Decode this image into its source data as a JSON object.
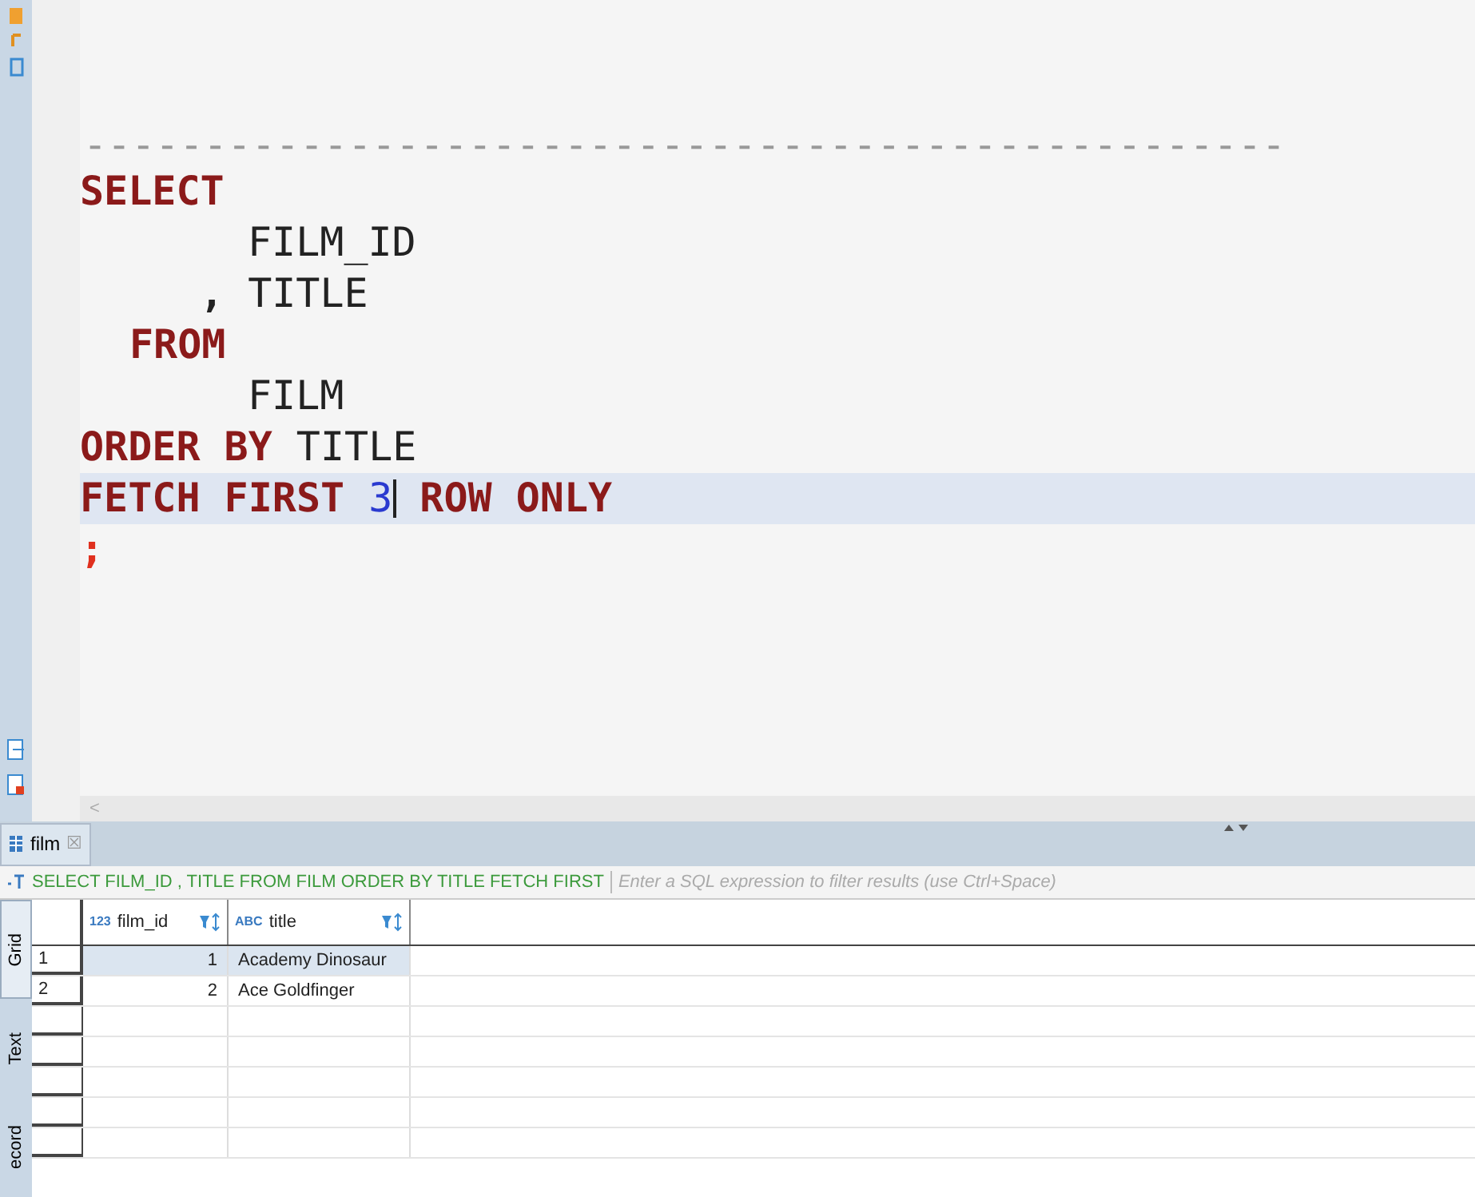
{
  "editor": {
    "comment": "--------------------------------------------------",
    "lines": [
      {
        "kind": "clause",
        "current": false,
        "tokens": [
          {
            "kind": "keyword",
            "text": "SELECT"
          }
        ]
      },
      {
        "kind": "item",
        "current": false,
        "tokens": [
          {
            "kind": "ident",
            "text": "FILM_ID"
          }
        ]
      },
      {
        "kind": "comma_item",
        "current": false,
        "tokens": [
          {
            "kind": "punct",
            "text": ","
          },
          {
            "kind": "ident",
            "text": "TITLE"
          }
        ]
      },
      {
        "kind": "sub_clause",
        "current": false,
        "tokens": [
          {
            "kind": "keyword",
            "text": "FROM"
          }
        ]
      },
      {
        "kind": "item",
        "current": false,
        "tokens": [
          {
            "kind": "ident",
            "text": "FILM"
          }
        ]
      },
      {
        "kind": "clause",
        "current": false,
        "tokens": [
          {
            "kind": "keyword",
            "text": "ORDER BY"
          },
          {
            "kind": "ident",
            "text": "TITLE"
          }
        ]
      },
      {
        "kind": "clause",
        "current": true,
        "tokens": [
          {
            "kind": "keyword",
            "text": "FETCH FIRST"
          },
          {
            "kind": "number",
            "text": "3",
            "cursor": true
          },
          {
            "kind": "keyword",
            "text": "ROW ONLY"
          }
        ]
      },
      {
        "kind": "clause",
        "current": false,
        "tokens": [
          {
            "kind": "terminator",
            "text": ";"
          }
        ]
      }
    ],
    "scroll_left": "<"
  },
  "results": {
    "tab": {
      "label": "film",
      "close": "☒"
    },
    "query": "SELECT FILM_ID , TITLE FROM FILM ORDER BY TITLE FETCH FIRST",
    "filter": {
      "placeholder": "Enter a SQL expression to filter results (use Ctrl+Space)"
    },
    "side_tabs": [
      {
        "label": "Grid",
        "selected": true
      },
      {
        "label": "Text",
        "selected": false
      },
      {
        "label": "ecord",
        "selected": false
      }
    ],
    "columns": [
      {
        "type": "123",
        "name": "film_id",
        "kind": "numeric"
      },
      {
        "type": "ABC",
        "name": "title",
        "kind": "text"
      }
    ],
    "rows": [
      {
        "number": "1",
        "selected": true,
        "cells": [
          "1",
          "Academy Dinosaur"
        ]
      },
      {
        "number": "2",
        "selected": false,
        "cells": [
          "2",
          "Ace Goldfinger"
        ]
      }
    ]
  }
}
